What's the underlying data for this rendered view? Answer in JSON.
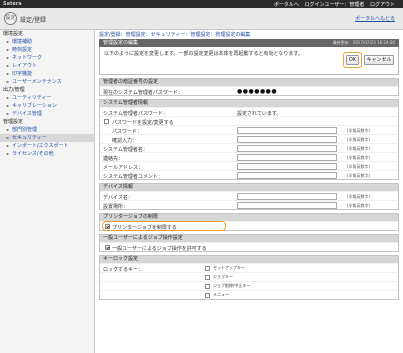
{
  "topbar": {
    "logo": "Satera",
    "links": [
      "ポータルへ",
      "ログインユーザー：管理者",
      "ログアウト"
    ]
  },
  "header": {
    "icon_text": "設定",
    "title": "設定/登録",
    "portal_link": "ポータルへもどる"
  },
  "sidebar": {
    "sections": [
      {
        "heading": "環境設定",
        "items": [
          "環境補助",
          "時刻設定",
          "ネットワーク",
          "レイアウト",
          "印字機能",
          "ユーザーメンテナンス"
        ]
      },
      {
        "heading": "出力/管理",
        "items": [
          "ユーティリティー",
          "キャリブレーション",
          "デバイス管理"
        ]
      },
      {
        "heading": "管理設定",
        "items": [
          "部門別管理",
          "セキュリティー",
          "インポート/エクスポート",
          "ライセンス/その他"
        ]
      }
    ],
    "active_item": "セキュリティー"
  },
  "breadcrumb": "設定/登録：管理設定：セキュリティー：管理設定：管理設定の編集",
  "editor": {
    "title": "管理設定の編集",
    "last_updated": "最終更新：2017/07/23 16:24:00",
    "message": "以下のように設定を変更します。一部の設定変更は本体を再起動すると有効となります。",
    "ok_label": "OK",
    "cancel_label": "キャンセル"
  },
  "sections": {
    "admin_password": {
      "header": "管理者の暗証番号の設定",
      "label": "現在のシステム管理者パスワード：",
      "masked": "●●●●●●●"
    },
    "system_admin": {
      "header": "システム管理者情報",
      "rows": [
        {
          "label": "システム管理者パスワード：",
          "value": "設定されています。"
        },
        {
          "label": "パスワードを設定/変更する",
          "checkbox": true
        },
        {
          "label": "パスワード：",
          "note": "(半角英数字)"
        },
        {
          "label": "確認入力：",
          "note": "(半角英数字)"
        },
        {
          "label": "システム管理者名：",
          "note": "(半角英数字)"
        },
        {
          "label": "連絡先：",
          "note": "(半角英数字)"
        },
        {
          "label": "メールアドレス：",
          "note": "(半角英数字)"
        },
        {
          "label": "システム管理者コメント：",
          "note": "(半角英数字)"
        }
      ]
    },
    "device_info": {
      "header": "デバイス情報",
      "rows": [
        {
          "label": "デバイス名：",
          "note": "(半角英数字)"
        },
        {
          "label": "設置場所：",
          "note": "(半角英数字)"
        }
      ]
    },
    "printer_job": {
      "header": "プリンタージョブの制限",
      "option": "プリンタージョブを制限する"
    },
    "job_ops": {
      "header": "一般ユーザーによるジョブ操作設定",
      "option": "一般ユーザーによるジョブ操作を許可する"
    },
    "key_lock": {
      "header": "キーロック設定",
      "label": "ロックするキー：",
      "options": [
        "セットアップキー",
        "ジョブキー",
        "ジョブ削除/中止キー",
        "メニュー"
      ]
    }
  }
}
